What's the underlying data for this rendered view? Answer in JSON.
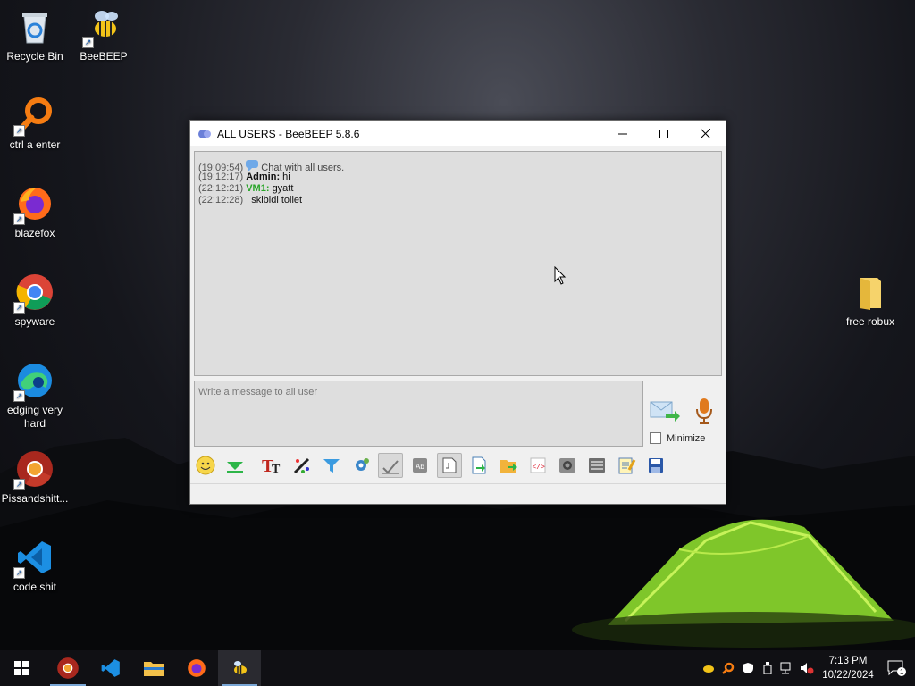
{
  "desktop": {
    "icons": [
      {
        "label": "Recycle Bin"
      },
      {
        "label": "BeeBEEP"
      },
      {
        "label": "ctrl a enter"
      },
      {
        "label": "blazefox"
      },
      {
        "label": "spyware"
      },
      {
        "label": "edging very hard"
      },
      {
        "label": "Pissandshitt..."
      },
      {
        "label": "code shit"
      },
      {
        "label": "free robux"
      }
    ]
  },
  "window": {
    "title": "ALL USERS - BeeBEEP 5.8.6",
    "messages": [
      {
        "time": "(19:09:54)",
        "user": "",
        "text": "Chat with all users."
      },
      {
        "time": "(19:12:17)",
        "user": "Admin:",
        "text": "hi"
      },
      {
        "time": "(22:12:21)",
        "user": "VM1:",
        "text": "gyatt"
      },
      {
        "time": "(22:12:28)",
        "user": "",
        "text": "skibidi toilet"
      }
    ],
    "input_placeholder": "Write a message to all user",
    "minimize_label": "Minimize"
  },
  "taskbar": {
    "time": "7:13 PM",
    "date": "10/22/2024",
    "notification_count": "1"
  },
  "colors": {
    "vm_user": "#2aa52a",
    "taskbar_bg": "#101014",
    "tent_green": "#8ed631"
  }
}
